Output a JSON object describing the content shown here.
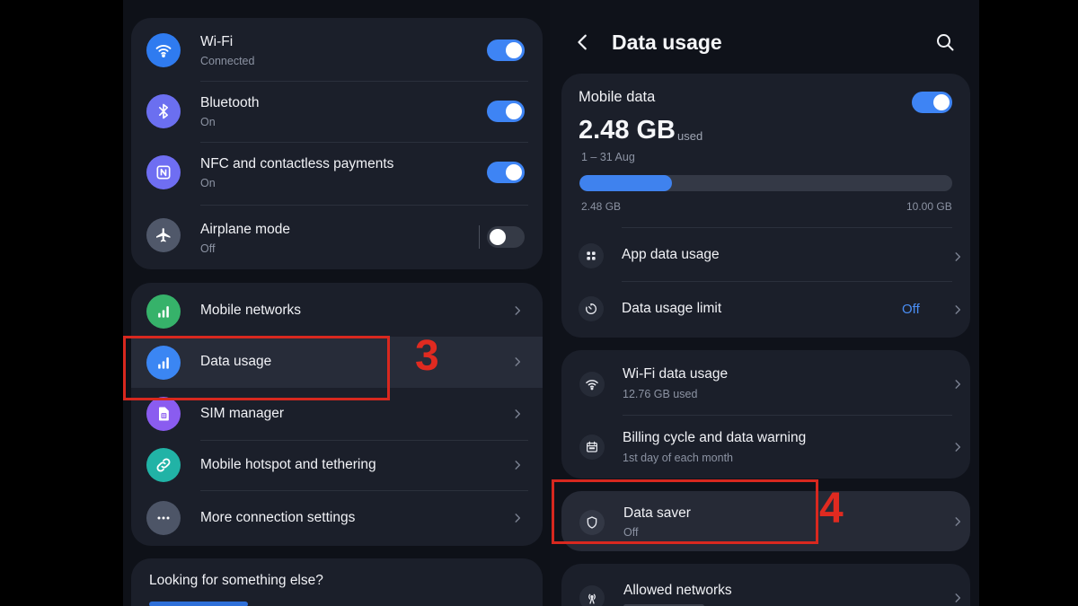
{
  "colors": {
    "accent": "#3e84f4",
    "wifi_icon_bg": "#2f7bf0",
    "bluetooth_icon_bg": "#6b6ff0",
    "nfc_icon_bg": "#6f6ef2",
    "airplane_icon_bg": "#50586a",
    "mobile_networks_icon_bg": "#36b26a",
    "data_usage_icon_bg": "#3b86f3",
    "sim_icon_bg": "#8a5cf0",
    "hotspot_icon_bg": "#21b3a6",
    "more_icon_bg": "#4d5567",
    "annotation": "#d8281f"
  },
  "left": {
    "connections": [
      {
        "title": "Wi-Fi",
        "status": "Connected",
        "icon": "wifi-icon",
        "toggle": "on"
      },
      {
        "title": "Bluetooth",
        "status": "On",
        "icon": "bluetooth-icon",
        "toggle": "on"
      },
      {
        "title": "NFC and contactless payments",
        "status": "On",
        "icon": "nfc-icon",
        "toggle": "on"
      },
      {
        "title": "Airplane mode",
        "status": "Off",
        "icon": "airplane-icon",
        "toggle": "off"
      }
    ],
    "menu": [
      {
        "title": "Mobile networks",
        "icon": "signal-bars-icon"
      },
      {
        "title": "Data usage",
        "icon": "data-usage-icon"
      },
      {
        "title": "SIM manager",
        "icon": "sim-card-icon"
      },
      {
        "title": "Mobile hotspot and tethering",
        "icon": "link-icon"
      },
      {
        "title": "More connection settings",
        "icon": "more-dots-icon"
      }
    ],
    "looking": {
      "title": "Looking for something else?"
    }
  },
  "right": {
    "header": {
      "title": "Data usage",
      "back_icon": "back-arrow-icon",
      "search_icon": "search-icon"
    },
    "mobile_data": {
      "label": "Mobile data",
      "toggle": "on",
      "amount": "2.48 GB",
      "used_label": "used",
      "period": "1 – 31 Aug",
      "progress_fraction": 0.248,
      "bar_min_label": "2.48 GB",
      "bar_max_label": "10.00 GB",
      "items": [
        {
          "title": "App data usage",
          "icon": "apps-grid-icon"
        },
        {
          "title": "Data usage limit",
          "value": "Off",
          "icon": "timer-icon"
        }
      ]
    },
    "wifi_card": [
      {
        "title": "Wi-Fi data usage",
        "sub": "12.76 GB used",
        "icon": "wifi-icon"
      },
      {
        "title": "Billing cycle and data warning",
        "sub": "1st day of each month",
        "icon": "calendar-icon"
      }
    ],
    "data_saver": {
      "title": "Data saver",
      "sub": "Off",
      "icon": "shield-icon"
    },
    "allowed": {
      "title": "Allowed networks",
      "icon": "cell-tower-icon"
    }
  },
  "annotations": {
    "step3": "3",
    "step4": "4"
  }
}
